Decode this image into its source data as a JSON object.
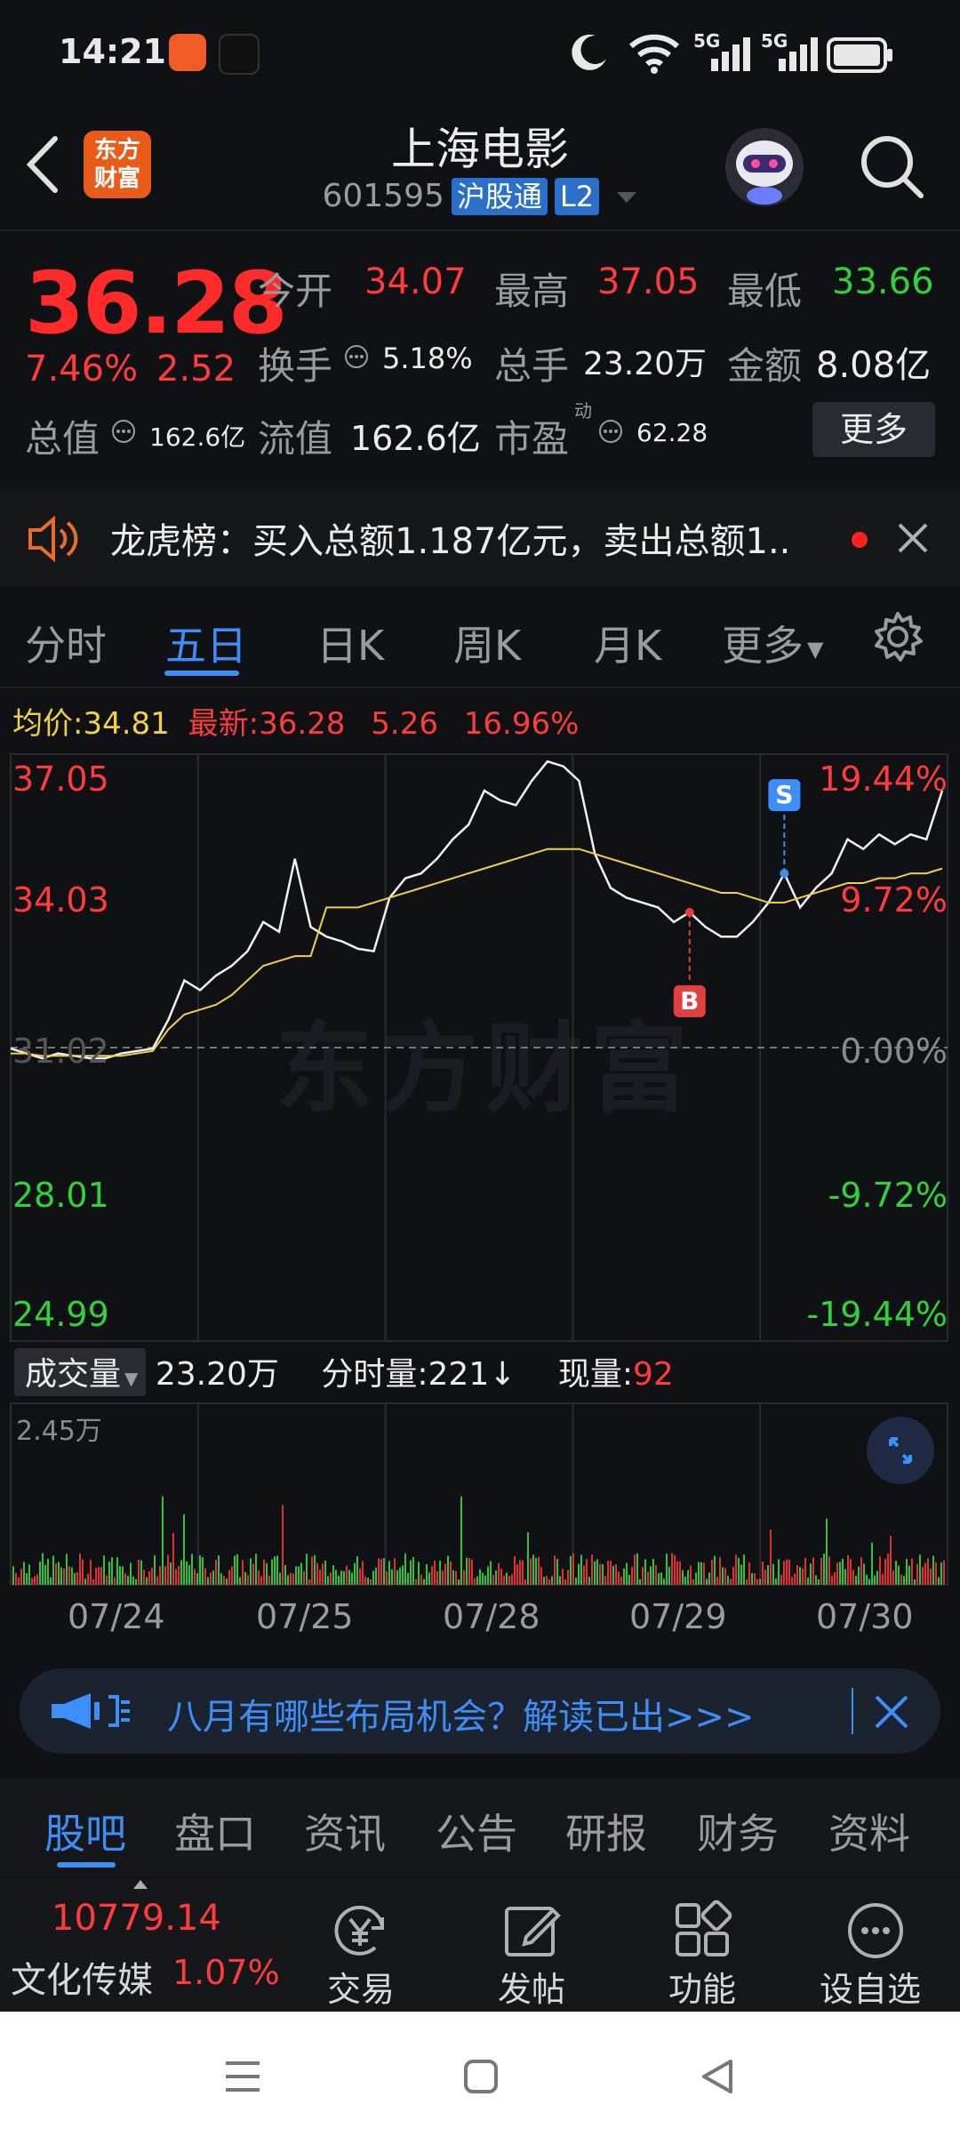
{
  "status": {
    "time": "14:21",
    "net1": "5G",
    "net2": "5G"
  },
  "header": {
    "title": "上海电影",
    "code": "601595",
    "badge1": "沪股通",
    "badge2": "L2",
    "logo_line1": "东方",
    "logo_line2": "财富"
  },
  "quote": {
    "price": "36.28",
    "change_pct": "7.46%",
    "change": "2.52",
    "open_label": "今开",
    "open": "34.07",
    "high_label": "最高",
    "high": "37.05",
    "low_label": "最低",
    "low": "33.66",
    "turnover_label": "换手",
    "turnover": "5.18%",
    "volume_label": "总手",
    "volume": "23.20万",
    "amount_label": "金额",
    "amount": "8.08亿",
    "mktcap_label": "总值",
    "mktcap": "162.6亿",
    "float_label": "流值",
    "float": "162.6亿",
    "pe_label": "市盈",
    "pe_sup": "动",
    "pe": "62.28",
    "more_label": "更多"
  },
  "notice": {
    "text": "龙虎榜：买入总额1.187亿元，卖出总额1.."
  },
  "tabs": [
    "分时",
    "五日",
    "日K",
    "周K",
    "月K",
    "更多"
  ],
  "chart_header": {
    "avg_label": "均价:",
    "avg": "34.81",
    "latest_label": "最新:",
    "latest": "36.28",
    "chg": "5.26",
    "pct": "16.96%"
  },
  "chart_data": {
    "type": "line",
    "title": "",
    "y_left_ticks": [
      "37.05",
      "34.03",
      "31.02",
      "28.01",
      "24.99"
    ],
    "y_right_ticks": [
      "19.44%",
      "9.72%",
      "0.00%",
      "-9.72%",
      "-19.44%"
    ],
    "x_ticks": [
      "07/24",
      "07/25",
      "07/28",
      "07/29",
      "07/30"
    ],
    "ylim": [
      24.99,
      37.05
    ],
    "baseline": 31.02,
    "series": [
      {
        "values": [
          31.0,
          30.9,
          30.8,
          30.9,
          30.85,
          30.8,
          30.8,
          30.9,
          30.95,
          31.0,
          31.6,
          32.4,
          32.2,
          32.5,
          32.7,
          33.0,
          33.6,
          33.4,
          34.9,
          33.5,
          33.3,
          33.2,
          33.05,
          33.0,
          34.1,
          34.5,
          34.6,
          34.9,
          35.3,
          35.6,
          36.3,
          36.1,
          36.0,
          36.5,
          36.9,
          36.8,
          36.5,
          35.0,
          34.3,
          34.1,
          34.0,
          33.9,
          33.6,
          33.8,
          33.5,
          33.3,
          33.3,
          33.6,
          34.0,
          34.6,
          33.9,
          34.3,
          34.6,
          35.3,
          35.1,
          35.4,
          35.2,
          35.4,
          35.3,
          36.3
        ]
      },
      {
        "values": [
          30.9,
          30.9,
          30.85,
          30.85,
          30.85,
          30.85,
          30.85,
          30.85,
          30.9,
          30.95,
          31.4,
          31.7,
          31.8,
          31.9,
          32.1,
          32.4,
          32.7,
          32.8,
          32.9,
          32.9,
          33.9,
          33.9,
          33.9,
          34.0,
          34.1,
          34.2,
          34.3,
          34.4,
          34.5,
          34.6,
          34.7,
          34.8,
          34.9,
          35.0,
          35.1,
          35.1,
          35.1,
          35.0,
          34.9,
          34.8,
          34.7,
          34.6,
          34.5,
          34.4,
          34.3,
          34.2,
          34.2,
          34.1,
          34.0,
          34.0,
          34.1,
          34.2,
          34.3,
          34.4,
          34.4,
          34.5,
          34.5,
          34.6,
          34.6,
          34.7
        ]
      }
    ],
    "markers": [
      {
        "label": "B"
      },
      {
        "label": "S"
      }
    ]
  },
  "volume": {
    "label": "成交量",
    "total": "23.20万",
    "tick_label": "分时量:221↓",
    "now_label": "现量:",
    "now": "92",
    "max": "2.45万"
  },
  "banner": {
    "text": "八月有哪些布局机会？解读已出>>>"
  },
  "bottom_tabs": [
    "股吧",
    "盘口",
    "资讯",
    "公告",
    "研报",
    "财务",
    "资料"
  ],
  "bottom_bar": {
    "index_value": "10779.14",
    "index_name": "文化传媒",
    "index_pct": "1.07%",
    "actions": [
      "交易",
      "发帖",
      "功能",
      "设自选"
    ]
  },
  "watermark": "东方财富"
}
